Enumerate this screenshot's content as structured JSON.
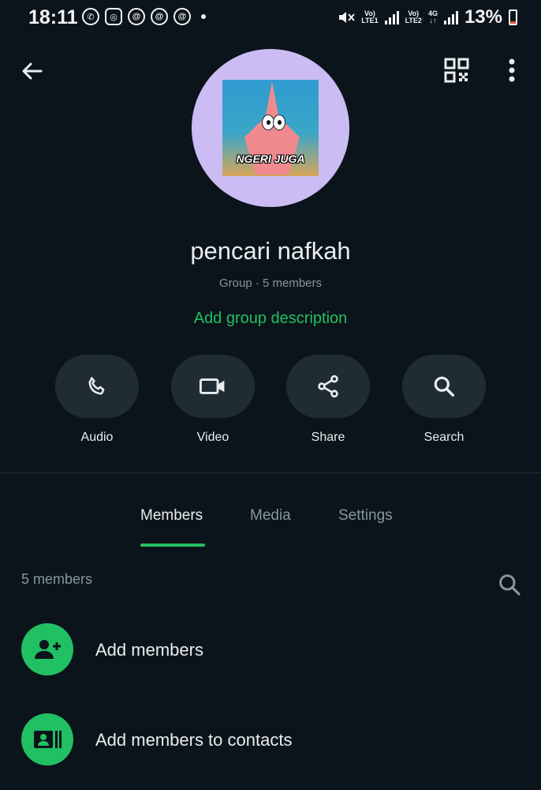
{
  "status_bar": {
    "time": "18:11",
    "net1_top": "Vo)",
    "net1_bottom": "LTE1",
    "net2_top": "Vo)",
    "net2_bottom": "LTE2",
    "net2_type": "4G",
    "battery": "13%"
  },
  "header": {
    "back_icon": "arrow-left-icon",
    "qr_icon": "qr-code-icon",
    "menu_icon": "more-vertical-icon"
  },
  "profile": {
    "avatar_caption": "NGERI JUGA",
    "name": "pencari nafkah",
    "subtitle": "Group · 5 members",
    "add_description": "Add group description"
  },
  "actions": [
    {
      "label": "Audio",
      "icon": "phone-icon"
    },
    {
      "label": "Video",
      "icon": "video-camera-icon"
    },
    {
      "label": "Share",
      "icon": "share-icon"
    },
    {
      "label": "Search",
      "icon": "search-icon"
    }
  ],
  "tabs": [
    {
      "label": "Members",
      "active": true
    },
    {
      "label": "Media",
      "active": false
    },
    {
      "label": "Settings",
      "active": false
    }
  ],
  "members": {
    "count_label": "5 members",
    "rows": [
      {
        "label": "Add members",
        "icon": "add-person-icon"
      },
      {
        "label": "Add members to contacts",
        "icon": "contact-card-icon"
      }
    ]
  },
  "colors": {
    "background": "#0b141a",
    "accent": "#21c063",
    "button_bg": "#202c33",
    "avatar_ring": "#cbbcf4",
    "muted_text": "#8696a0"
  }
}
